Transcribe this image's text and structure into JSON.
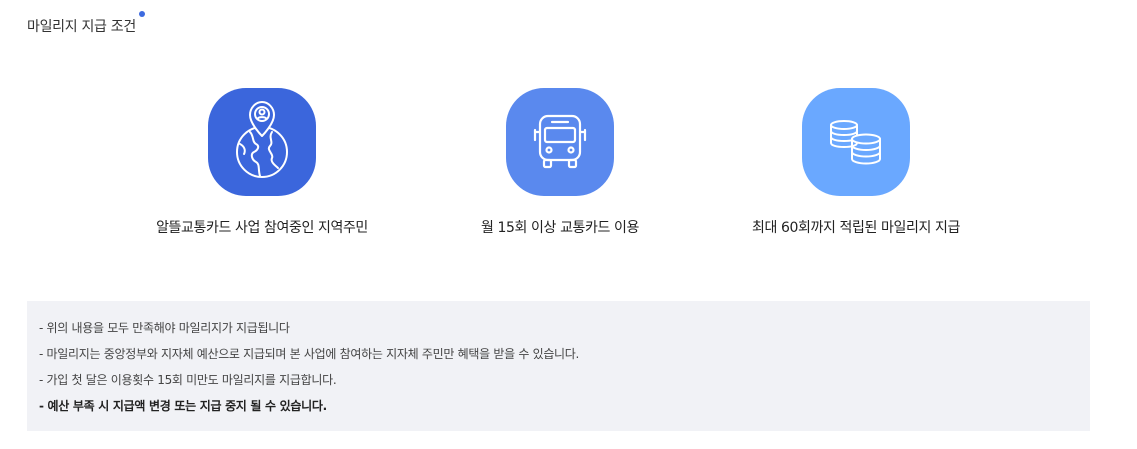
{
  "section": {
    "title": "마일리지 지급 조건"
  },
  "conditions": [
    {
      "label": "알뜰교통카드 사업 참여중인 지역주민",
      "icon": "location-globe-icon",
      "color": "#3b66dc"
    },
    {
      "label": "월 15회 이상 교통카드 이용",
      "icon": "bus-icon",
      "color": "#5a89ee"
    },
    {
      "label": "최대 60회까지 적립된 마일리지 지급",
      "icon": "coins-icon",
      "color": "#6aa8ff"
    }
  ],
  "notices": [
    "- 위의 내용을 모두 만족해야 마일리지가 지급됩니다",
    "- 마일리지는 중앙정부와 지자체 예산으로 지급되며 본 사업에 참여하는 지자체 주민만 혜택을 받을 수 있습니다.",
    "- 가입 첫 달은 이용횟수 15회 미만도 마일리지를 지급합니다.",
    "- 예산 부족 시 지급액 변경 또는 지급 중지 될 수 있습니다."
  ],
  "colors": {
    "accent": "#3d6be0",
    "notice_bg": "#f1f2f6"
  }
}
